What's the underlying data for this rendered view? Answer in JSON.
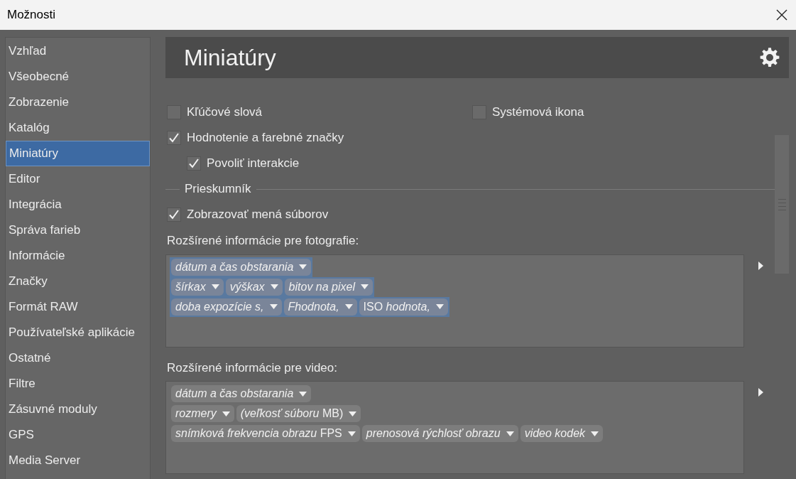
{
  "window": {
    "title": "Možnosti"
  },
  "sidebar": {
    "items": [
      {
        "label": "Vzhľad",
        "selected": false
      },
      {
        "label": "Všeobecné",
        "selected": false
      },
      {
        "label": "Zobrazenie",
        "selected": false
      },
      {
        "label": "Katalóg",
        "selected": false
      },
      {
        "label": "Miniatúry",
        "selected": true
      },
      {
        "label": "Editor",
        "selected": false
      },
      {
        "label": "Integrácia",
        "selected": false
      },
      {
        "label": "Správa farieb",
        "selected": false
      },
      {
        "label": "Informácie",
        "selected": false
      },
      {
        "label": "Značky",
        "selected": false
      },
      {
        "label": "Formát RAW",
        "selected": false
      },
      {
        "label": "Používateľské aplikácie",
        "selected": false
      },
      {
        "label": "Ostatné",
        "selected": false
      },
      {
        "label": "Filtre",
        "selected": false
      },
      {
        "label": "Zásuvné moduly",
        "selected": false
      },
      {
        "label": "GPS",
        "selected": false
      },
      {
        "label": "Media Server",
        "selected": false
      }
    ]
  },
  "header": {
    "title": "Miniatúry"
  },
  "options": {
    "keywords": {
      "label": "Kľúčové slová",
      "checked": false
    },
    "system_icon": {
      "label": "Systémová ikona",
      "checked": false
    },
    "rating": {
      "label": "Hodnotenie a farebné značky",
      "checked": true
    },
    "interaction": {
      "label": "Povoliť interakcie",
      "checked": true
    }
  },
  "explorer": {
    "title": "Prieskumník",
    "show_names": {
      "label": "Zobrazovať mená súborov",
      "checked": true
    }
  },
  "photo_info": {
    "label": "Rozšírené informácie pre fotografie:",
    "tags": [
      {
        "text": "*dátum a čas obstarania*",
        "selected": true,
        "kind": "line_start"
      },
      {
        "text": "*šírkax*",
        "selected": true,
        "kind": "line_start"
      },
      {
        "text": "*výškax*",
        "selected": true,
        "kind": "inline"
      },
      {
        "text": "*bitov na pixel*",
        "selected": true,
        "kind": "inline"
      },
      {
        "text": "*doba expozície s,*",
        "selected": true,
        "kind": "line_start"
      },
      {
        "text": "*Fhodnota,*",
        "selected": true,
        "kind": "inline"
      },
      {
        "text": "ISO *hodnota,*",
        "selected": true,
        "kind": "inline"
      }
    ]
  },
  "video_info": {
    "label": "Rozšírené informácie pre video:",
    "tags": [
      {
        "text": "*dátum a čas obstarania*",
        "selected": false,
        "kind": "line_start"
      },
      {
        "text": "*rozmery*",
        "selected": false,
        "kind": "line_start"
      },
      {
        "text": "*(veľkosť súboru* MB)",
        "selected": false,
        "kind": "inline"
      },
      {
        "text": "*snímková frekvencia obrazu* FPS",
        "selected": false,
        "kind": "line_start"
      },
      {
        "text": "*prenosová rýchlosť obrazu*",
        "selected": false,
        "kind": "inline"
      },
      {
        "text": "*video kodek*",
        "selected": false,
        "kind": "inline"
      }
    ]
  }
}
